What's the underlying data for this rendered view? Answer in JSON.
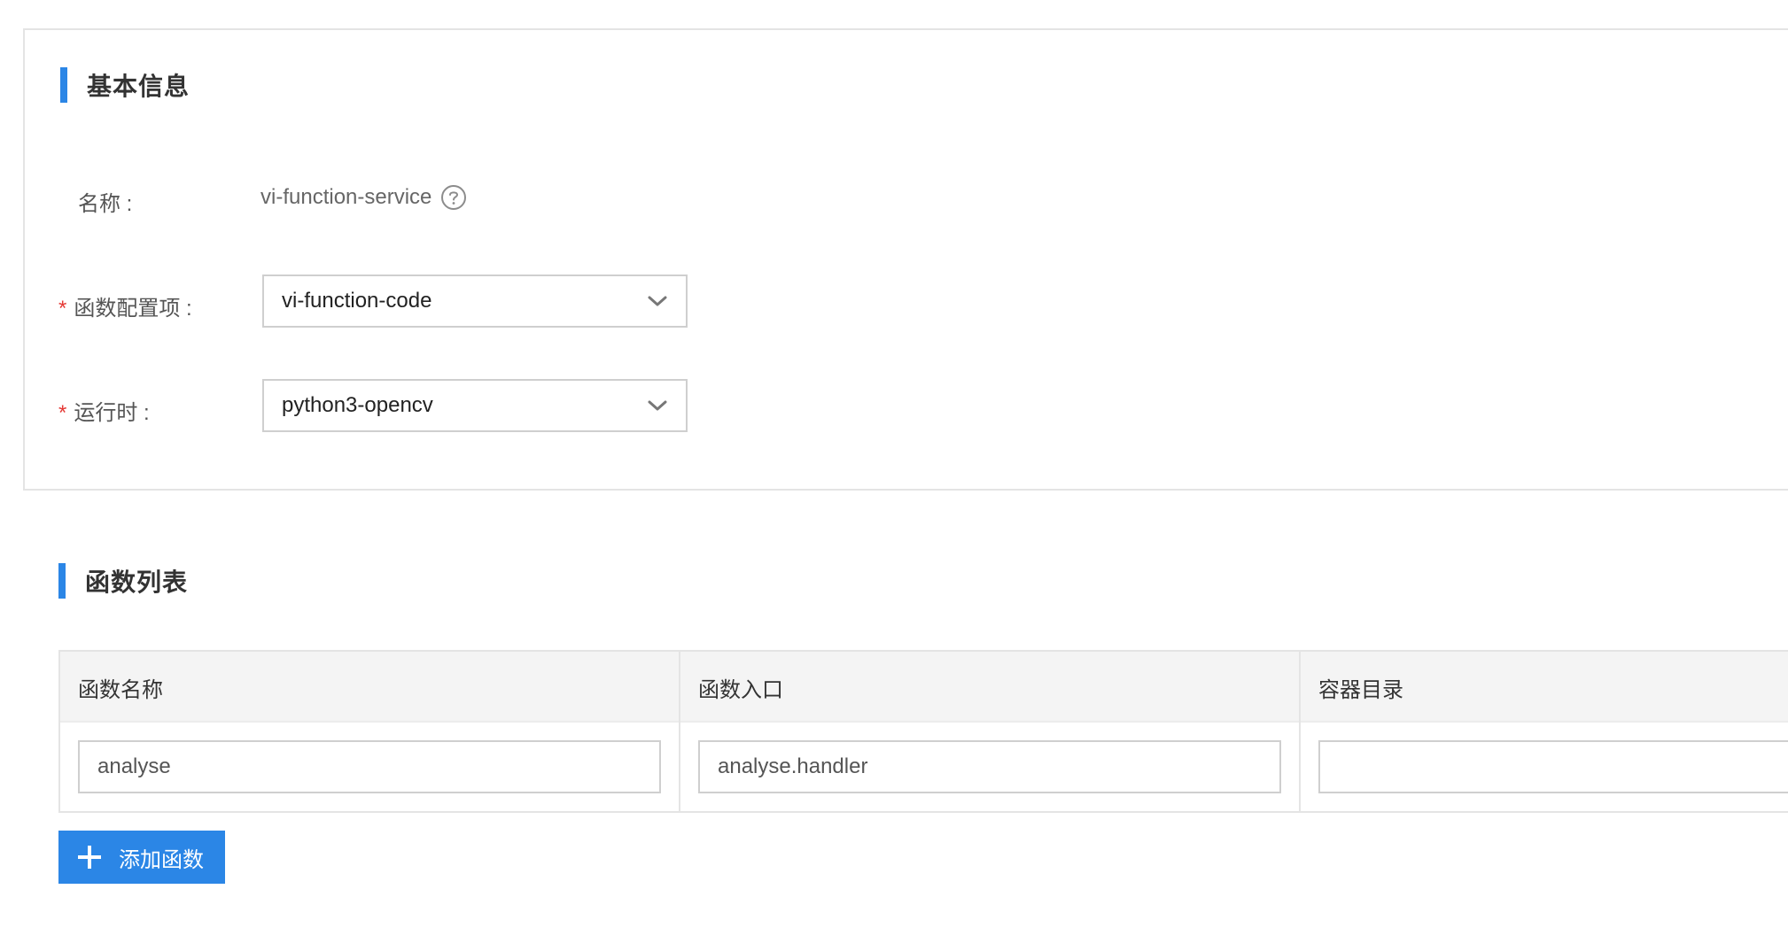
{
  "basic_info": {
    "title": "基本信息",
    "name_label": "名称 :",
    "name_value": "vi-function-service",
    "config_label": "函数配置项 :",
    "config_value": "vi-function-code",
    "runtime_label": "运行时 :",
    "runtime_value": "python3-opencv",
    "required_mark": "*"
  },
  "function_list": {
    "title": "函数列表",
    "columns": [
      "函数名称",
      "函数入口",
      "容器目录"
    ],
    "rows": [
      {
        "name": "analyse",
        "entry": "analyse.handler",
        "dir": ""
      }
    ],
    "add_button_label": "添加函数"
  },
  "colors": {
    "accent": "#2b86e6",
    "required": "#e53935",
    "header_bg": "#f4f4f4",
    "border": "#cfcfcf"
  },
  "icons": {
    "help": "question-circle-icon",
    "dropdown": "chevron-down-icon",
    "add": "plus-icon"
  }
}
